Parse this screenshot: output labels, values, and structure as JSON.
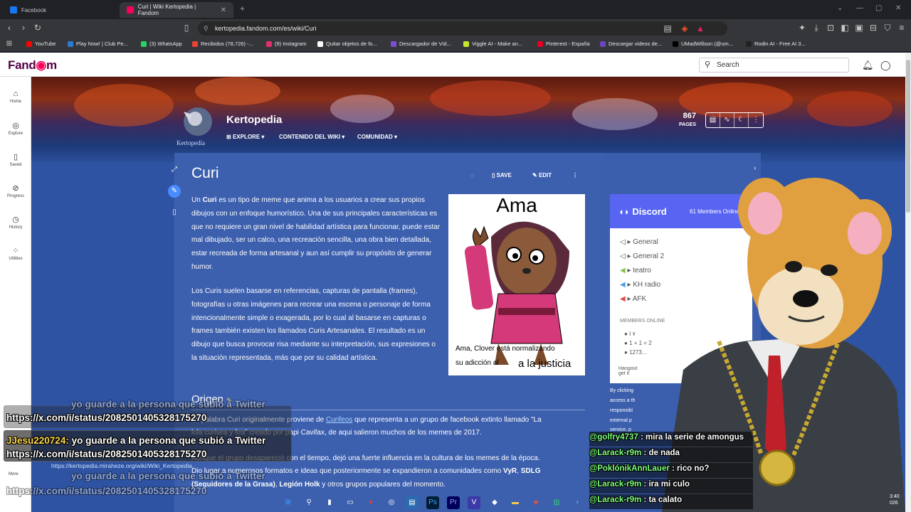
{
  "browser": {
    "tabs": [
      {
        "label": "Facebook",
        "active": false
      },
      {
        "label": "Curi | Wiki Kertopedia | Fandom",
        "active": true
      }
    ],
    "url": "kertopedia.fandom.com/es/wiki/Curi",
    "bookmarks": [
      {
        "label": "YouTube",
        "color": "#ff0000"
      },
      {
        "label": "Play Now! | Club Pe...",
        "color": "#2e7bd1"
      },
      {
        "label": "(3) WhatsApp",
        "color": "#25d366"
      },
      {
        "label": "Recibidos (78,726) -...",
        "color": "#ea4335"
      },
      {
        "label": "(9) Instagram",
        "color": "#e1306c"
      },
      {
        "label": "Quitar objetos de fo...",
        "color": "#ffffff"
      },
      {
        "label": "Descargador de Víd...",
        "color": "#7b4dd6"
      },
      {
        "label": "Viggle AI - Make an...",
        "color": "#c6e82b"
      },
      {
        "label": "Pinterest - España",
        "color": "#e60023"
      },
      {
        "label": "Descargar videos de...",
        "color": "#6b46c1"
      },
      {
        "label": "UMadWillson (@um...",
        "color": "#000000"
      },
      {
        "label": "Rodin AI - Free AI 3...",
        "color": "#222222"
      }
    ]
  },
  "fandom": {
    "logo_a": "Fand",
    "logo_b": "m",
    "search_placeholder": "Search",
    "sidebar": [
      {
        "label": "Home",
        "icon": "⌂"
      },
      {
        "label": "Explore",
        "icon": "◎"
      },
      {
        "label": "Saved",
        "icon": "▯"
      },
      {
        "label": "Progress",
        "icon": "⊘"
      },
      {
        "label": "History",
        "icon": "◷"
      },
      {
        "label": "Utilities",
        "icon": "⁘"
      }
    ]
  },
  "wiki": {
    "name": "Kertopedia",
    "logo_caption": "Kertopedia",
    "nav": [
      "EXPLORE",
      "CONTENIDO DEL WIKI",
      "COMUNIDAD"
    ],
    "pages_count": "867",
    "pages_label": "PAGES"
  },
  "article": {
    "title": "Curi",
    "actions": {
      "save": "SAVE",
      "edit": "EDIT"
    },
    "p1_a": "Un ",
    "p1_b": "Curi",
    "p1_c": " es un tipo de meme que anima a los usuarios a crear sus propios dibujos con un enfoque humorístico. Una de sus principales características es que no requiere un gran nivel de habilidad artística para funcionar, puede estar mal dibujado, ser un calco, una recreación sencilla, una obra bien detallada, estar recreada de forma artesanal y aun así cumplir su propósito de generar humor.",
    "p2": "Los Curis suelen basarse en referencias, capturas de pantalla (frames), fotografías u otras imágenes para recrear una escena o personaje de forma intencionalmente simple o exagerada, por lo cual al basarse en capturas o frames también existen los llamados Curis Artesanales. El resultado es un dibujo que busca provocar risa mediante su interpretación, sus expresiones o la situación representada, más que por su calidad artística.",
    "h2": "Origen",
    "o1_a": "La palabra Curi originalmente proviene de ",
    "o1_link": "Curifeos",
    "o1_b": " que representa a un grupo de facebook extinto llamado \"La",
    "o2": "lola curisea y fea\" creado por papi Cavifax, de aqui salieron muchos de los memes de 2017.",
    "o3": "Aunque el grupo desapareció con el tiempo, dejó una fuerte influencia en la cultura de los memes de la época.",
    "o4_a": "Dio lugar a numerosos formatos e ideas que posteriormente se expandieron a comunidades como ",
    "o4_b": "VyR",
    "o4_c": ", ",
    "o4_d": "SDLG",
    "o5_a": "(Seguidores de la Grasa)",
    "o5_b": ", ",
    "o5_c": "Legión Holk",
    "o5_d": " y otros grupos populares del momento.",
    "infobox": {
      "top": "Ama",
      "mid1": "Ama, Clover está normalizando",
      "mid2": "su adicción al",
      "bot": "a la justicia"
    }
  },
  "discord": {
    "title": "Discord",
    "members": "61 Members Online",
    "channels": [
      "▸ General",
      "▸ General 2",
      "▸ teatro",
      "▸ KH radio",
      "▸ AFK"
    ],
    "members_online_label": "MEMBERS ONLINE",
    "users": [
      "I ۷",
      "1 + 1 = 2",
      "1273..."
    ],
    "hangout_1": "Hangout",
    "hangout_2": "get it"
  },
  "rail_text": [
    "By clicking",
    "access a th",
    "responsibl",
    "external p",
    "service, p"
  ],
  "stream_overlay": {
    "left_msgs": [
      {
        "user": "",
        "text": "yo guarde a la persona que subió a Twitter"
      },
      {
        "user": "",
        "text": "https://x.com/i/status/2082501405328175270"
      },
      {
        "user": "JJesu220724:",
        "text": " yo guarde a la persona que subió a Twitter"
      },
      {
        "user": "",
        "text": "https://x.com/i/status/2082501405328175270"
      },
      {
        "user": "",
        "text": "yo guarde a la persona que subió a Twitter"
      },
      {
        "user": "",
        "text": "https://x.com/i/status/2082501405328175270"
      }
    ],
    "kerto_link": "https://kertopedia.miraheze.org/wiki/Wiki_Kertopedia",
    "more_label": "More",
    "chat": [
      {
        "user": "@golfry4737",
        "text": " : mira la serie de amongus"
      },
      {
        "user": "@Larack-r9m",
        "text": " : de nada"
      },
      {
        "user": "@PoklónikAnnLauer",
        "text": " : rico no?"
      },
      {
        "user": "@Larack-r9m",
        "text": " : ira mi culo"
      },
      {
        "user": "@Larack-r9m",
        "text": " : ta calato"
      }
    ],
    "clock_1": "3:40",
    "clock_2": "026"
  }
}
